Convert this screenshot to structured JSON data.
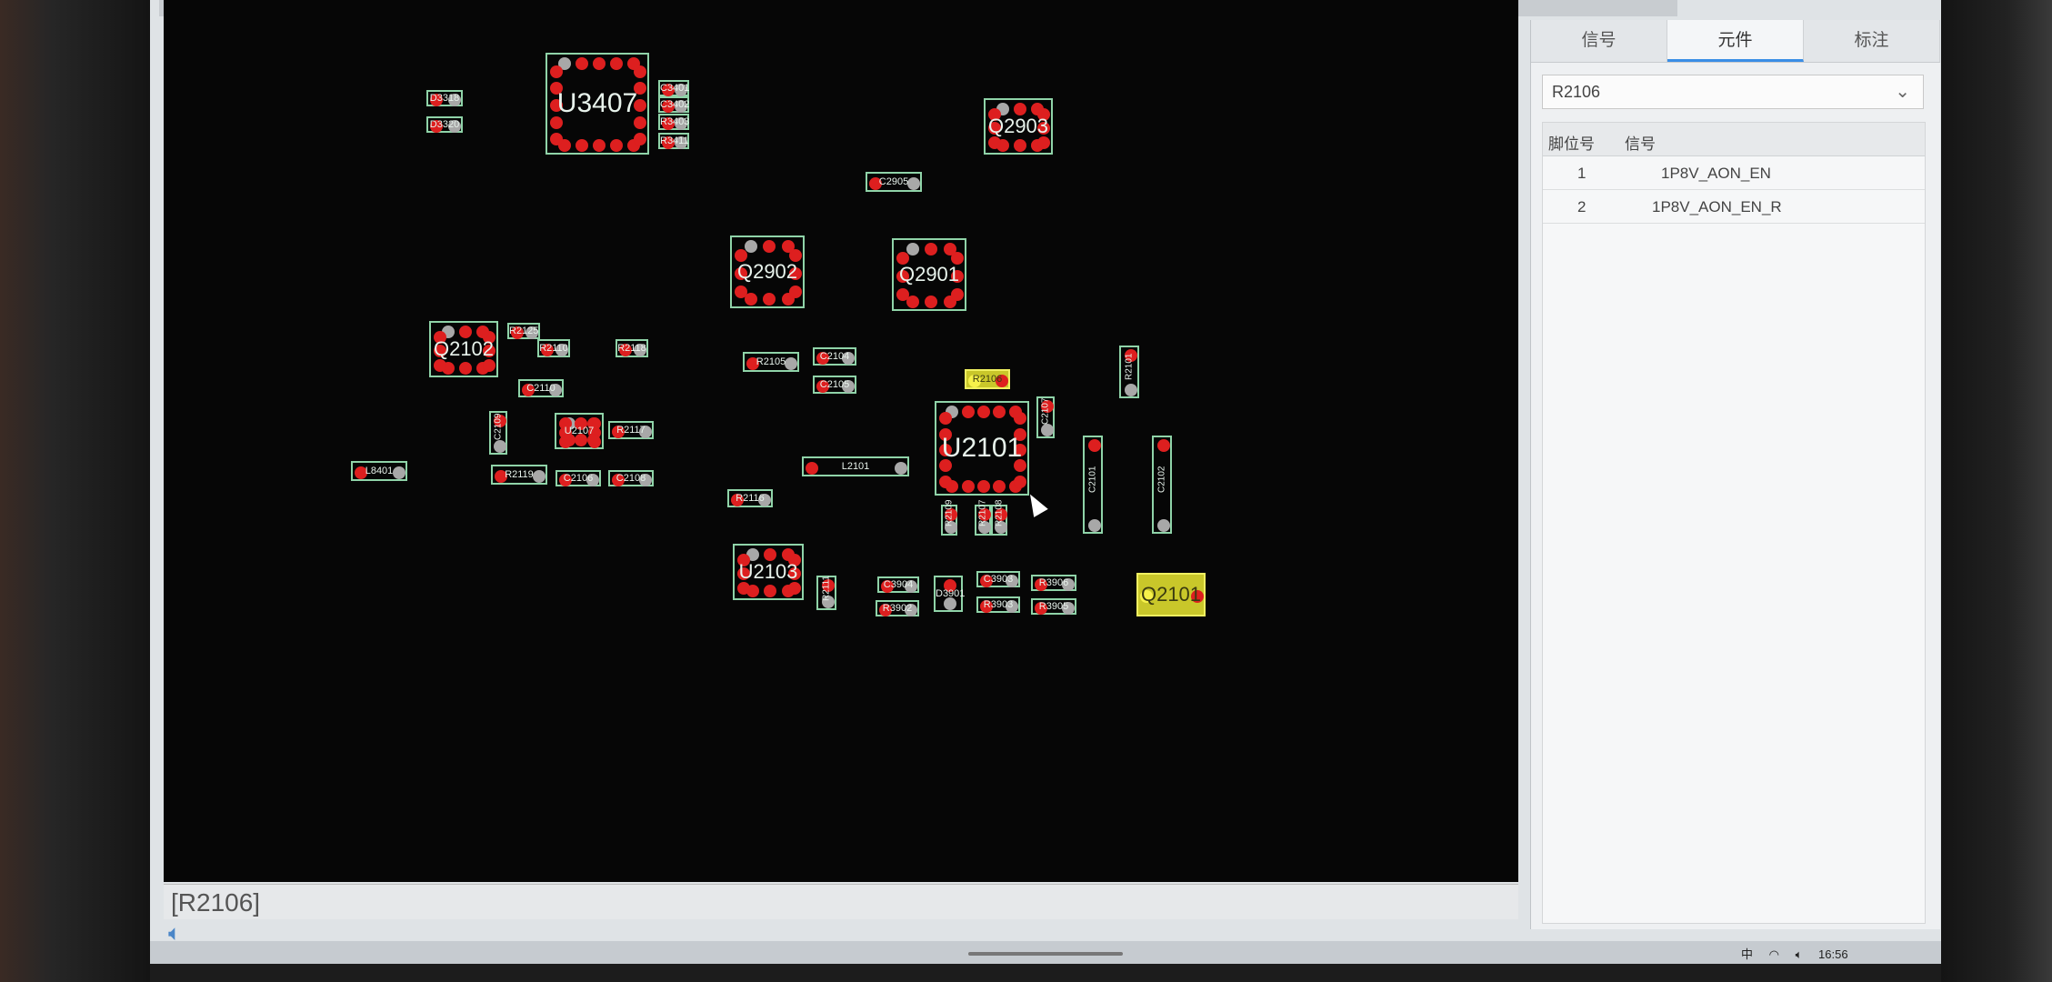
{
  "selected_component": "R2106",
  "status_bar": {
    "text": "[R2106]",
    "speaker_icon": "speaker-icon"
  },
  "panel": {
    "tabs": [
      {
        "label": "信号"
      },
      {
        "label": "元件",
        "active": true
      },
      {
        "label": "标注"
      }
    ],
    "component_select": {
      "value": "R2106"
    },
    "table": {
      "headers": [
        "脚位号",
        "信号"
      ],
      "rows": [
        {
          "pin": "1",
          "signal": "1P8V_AON_EN"
        },
        {
          "pin": "2",
          "signal": "1P8V_AON_EN_R"
        }
      ]
    }
  },
  "tray": {
    "ime": "中",
    "clock": "16:56"
  },
  "colors": {
    "board_bg": "#060606",
    "outline": "#8fd3a8",
    "pad": "#dd1f1f",
    "pad_gray": "#a8a8a8",
    "highlight": "#c9c72a",
    "tab_accent": "#3a8ee6"
  },
  "components": [
    {
      "label": "U3407",
      "size": "huge"
    },
    {
      "label": "Q2903",
      "size": "big"
    },
    {
      "label": "Q2902",
      "size": "big"
    },
    {
      "label": "Q2901",
      "size": "big"
    },
    {
      "label": "Q2102",
      "size": "big"
    },
    {
      "label": "U2101",
      "size": "huge"
    },
    {
      "label": "U2103",
      "size": "big"
    },
    {
      "label": "Q2101",
      "size": "big",
      "selected": true
    },
    {
      "label": "U2107"
    },
    {
      "label": "C2905"
    },
    {
      "label": "R2105"
    },
    {
      "label": "R2106",
      "selected": true
    },
    {
      "label": "L2101"
    },
    {
      "label": "R2116"
    },
    {
      "label": "R2117"
    },
    {
      "label": "R2119"
    },
    {
      "label": "R2110"
    },
    {
      "label": "C2110"
    },
    {
      "label": "L8401"
    },
    {
      "label": "C3904"
    },
    {
      "label": "R3902"
    },
    {
      "label": "C3903"
    },
    {
      "label": "R3903"
    },
    {
      "label": "R3906"
    },
    {
      "label": "R3905"
    },
    {
      "label": "C2101"
    },
    {
      "label": "C2102"
    },
    {
      "label": "R2101"
    },
    {
      "label": "C2104"
    },
    {
      "label": "C2105"
    },
    {
      "label": "D3318"
    },
    {
      "label": "D3320"
    },
    {
      "label": "C2106"
    },
    {
      "label": "C2108"
    },
    {
      "label": "R2125"
    },
    {
      "label": "R2118"
    },
    {
      "label": "C2109"
    },
    {
      "label": "C2107"
    },
    {
      "label": "C3401"
    },
    {
      "label": "C3402"
    },
    {
      "label": "R3403"
    },
    {
      "label": "R3411"
    },
    {
      "label": "R2107"
    },
    {
      "label": "R2108"
    },
    {
      "label": "R2109"
    },
    {
      "label": "D3901"
    },
    {
      "label": "R2111"
    }
  ]
}
